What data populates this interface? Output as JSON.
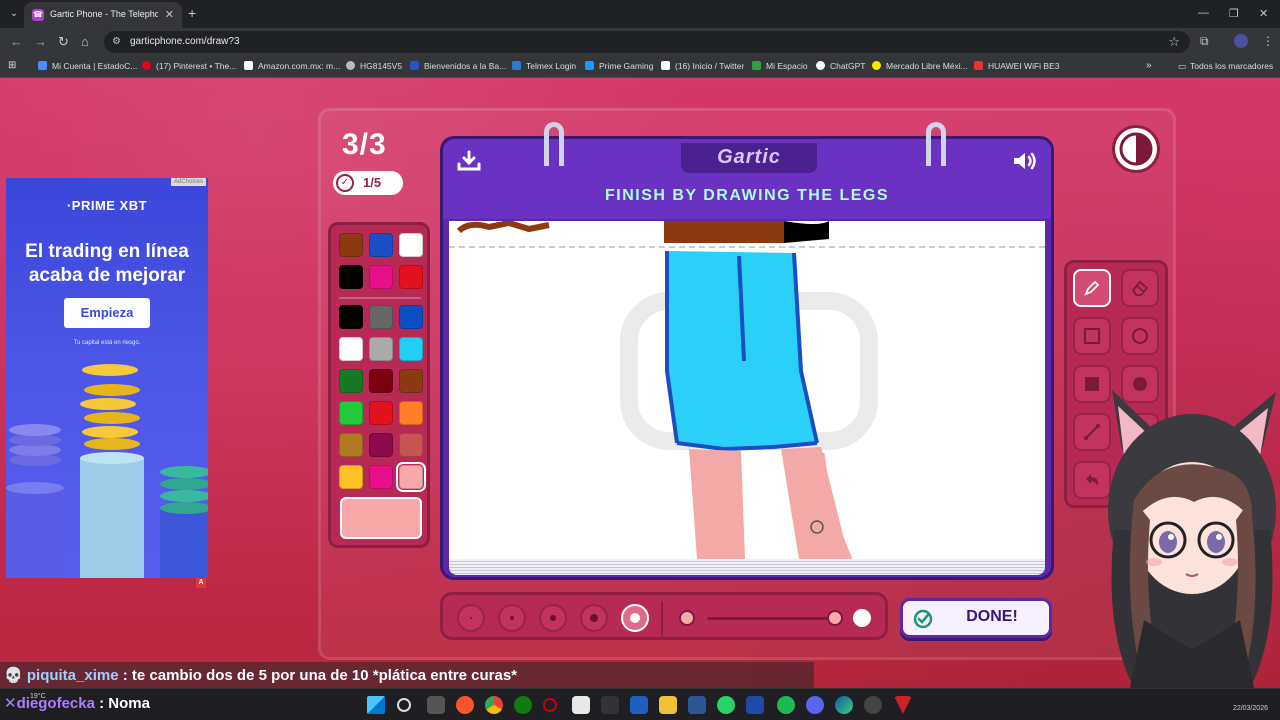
{
  "browser": {
    "tab_title": "Gartic Phone - The Telephone G",
    "url": "garticphone.com/draw?3",
    "bookmarks": [
      {
        "label": "Mi Cuenta | EstadoC...",
        "color": "#4a8cff"
      },
      {
        "label": "(17) Pinterest • The...",
        "color": "#e60023"
      },
      {
        "label": "Amazon.com.mx: m...",
        "color": "#ffffff"
      },
      {
        "label": "HG8145V5",
        "color": "#bbbbbb"
      },
      {
        "label": "Bienvenidos a la Ba...",
        "color": "#2d4fc8"
      },
      {
        "label": "Telmex Login",
        "color": "#2a7bd4"
      },
      {
        "label": "Prime Gaming",
        "color": "#1a98ff"
      },
      {
        "label": "(16) Inicio / Twitter",
        "color": "#ffffff"
      },
      {
        "label": "Mi Espacio",
        "color": "#2ea043"
      },
      {
        "label": "ChatGPT",
        "color": "#ffffff"
      },
      {
        "label": "Mercado Libre Méxi...",
        "color": "#ffe600"
      },
      {
        "label": "HUAWEI WiFi BE3",
        "color": "#e63535"
      }
    ],
    "all_bookmarks": "Todos los marcadores"
  },
  "ad": {
    "choices": "AdChoices",
    "brand": "·PRIME XBT",
    "headline": "El trading en línea acaba de mejorar",
    "cta": "Empieza",
    "risk": "Tu capital está en riesgo."
  },
  "game": {
    "round": "3/3",
    "players_done": "1/5",
    "logo": "Gartic",
    "task": "FINISH BY DRAWING THE LEGS",
    "done_label": "DONE!",
    "palette": [
      "#8b3a12",
      "#1a4fc4",
      "#ffffff",
      "#000000",
      "#e8108a",
      "#e3101e",
      "#000000",
      "#666666",
      "#0c4fc4",
      "#ffffff",
      "#aaaaaa",
      "#22d0f5",
      "#167a24",
      "#7d0010",
      "#8b3a12",
      "#22c93a",
      "#e3101e",
      "#ff7e26",
      "#b07a22",
      "#8f0a4a",
      "#c85353",
      "#ffc224",
      "#e8108a",
      "#f8a8a8"
    ],
    "current_color": "#f8a8a8",
    "brush_sizes": [
      1,
      2,
      3,
      4,
      5
    ],
    "active_brush_size": 5
  },
  "chat": {
    "user1": "piquita_xime",
    "msg1": " : te cambio dos de 5 por una de 10 *plática entre curas*",
    "user2": "diegofecka",
    "msg2": " : Noma"
  },
  "taskbar": {
    "weather": "19°C",
    "date": "22/03/2026"
  }
}
